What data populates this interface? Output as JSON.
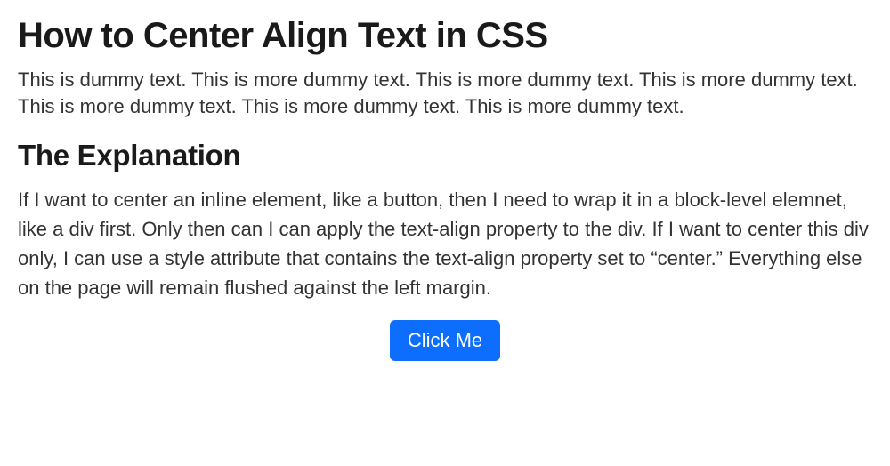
{
  "heading1": "How to Center Align Text in CSS",
  "paragraph1": "This is dummy text. This is more dummy text. This is more dummy text. This is more dummy text. This is more dummy text. This is more dummy text. This is more dummy text.",
  "heading2": "The Explanation",
  "paragraph2": "If I want to center an inline element, like a button, then I need to wrap it in a block-level elemnet, like a div first. Only then can I can apply the text-align property to the div. If I want to center this div only, I can use a style attribute that contains the text-align property set to “center.” Everything else on the page will remain flushed against the left margin.",
  "button": {
    "label": "Click Me"
  }
}
